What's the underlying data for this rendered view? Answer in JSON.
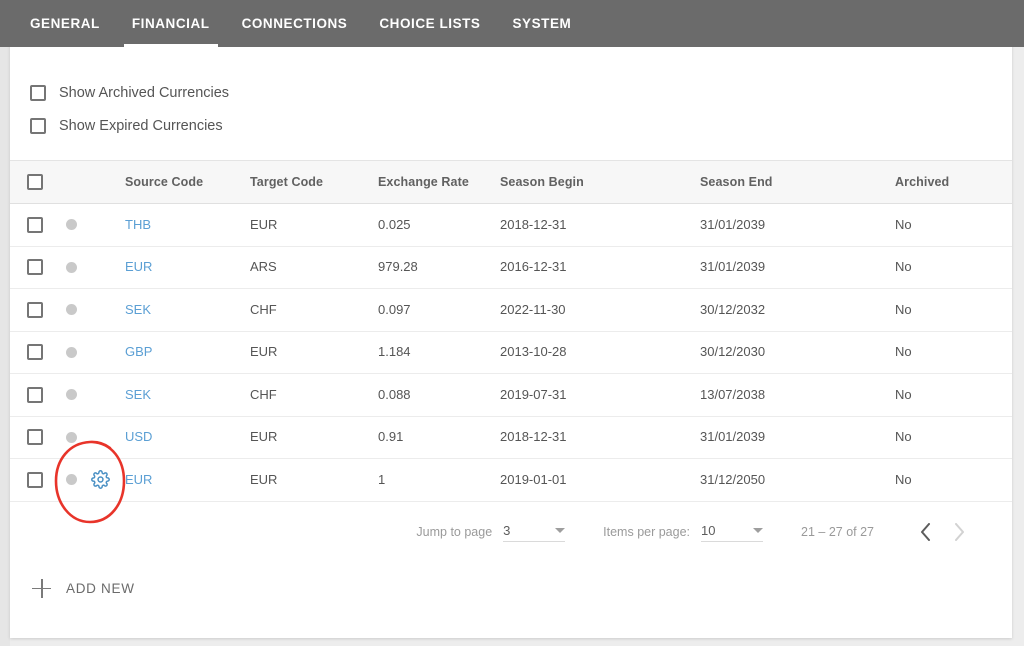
{
  "tabs": [
    {
      "label": "GENERAL",
      "active": false
    },
    {
      "label": "FINANCIAL",
      "active": true
    },
    {
      "label": "CONNECTIONS",
      "active": false
    },
    {
      "label": "CHOICE LISTS",
      "active": false
    },
    {
      "label": "SYSTEM",
      "active": false
    }
  ],
  "filters": [
    {
      "label": "Show Archived Currencies",
      "checked": false
    },
    {
      "label": "Show Expired Currencies",
      "checked": false
    }
  ],
  "table": {
    "columns": [
      "Source Code",
      "Target Code",
      "Exchange Rate",
      "Season Begin",
      "Season End",
      "Archived"
    ],
    "select_all_checked": false,
    "rows": [
      {
        "source": "THB",
        "target": "EUR",
        "rate": "0.025",
        "season_begin": "2018-12-31",
        "season_end": "31/01/2039",
        "archived": "No",
        "gear": false
      },
      {
        "source": "EUR",
        "target": "ARS",
        "rate": "979.28",
        "season_begin": "2016-12-31",
        "season_end": "31/01/2039",
        "archived": "No",
        "gear": false
      },
      {
        "source": "SEK",
        "target": "CHF",
        "rate": "0.097",
        "season_begin": "2022-11-30",
        "season_end": "30/12/2032",
        "archived": "No",
        "gear": false
      },
      {
        "source": "GBP",
        "target": "EUR",
        "rate": "1.184",
        "season_begin": "2013-10-28",
        "season_end": "30/12/2030",
        "archived": "No",
        "gear": false
      },
      {
        "source": "SEK",
        "target": "CHF",
        "rate": "0.088",
        "season_begin": "2019-07-31",
        "season_end": "13/07/2038",
        "archived": "No",
        "gear": false
      },
      {
        "source": "USD",
        "target": "EUR",
        "rate": "0.91",
        "season_begin": "2018-12-31",
        "season_end": "31/01/2039",
        "archived": "No",
        "gear": false
      },
      {
        "source": "EUR",
        "target": "EUR",
        "rate": "1",
        "season_begin": "2019-01-01",
        "season_end": "31/12/2050",
        "archived": "No",
        "gear": true
      }
    ]
  },
  "pagination": {
    "jump_label": "Jump to page",
    "jump_value": "3",
    "items_label": "Items per page:",
    "items_value": "10",
    "range": "21 – 27 of 27",
    "prev_enabled": true,
    "next_enabled": false
  },
  "add_new": {
    "label": "ADD NEW"
  },
  "colors": {
    "tabbar": "#6b6b6b",
    "link": "#5b9fd4",
    "gear": "#4a90c4",
    "annotation": "#e8342a",
    "header_bg": "#f7f7f7"
  }
}
